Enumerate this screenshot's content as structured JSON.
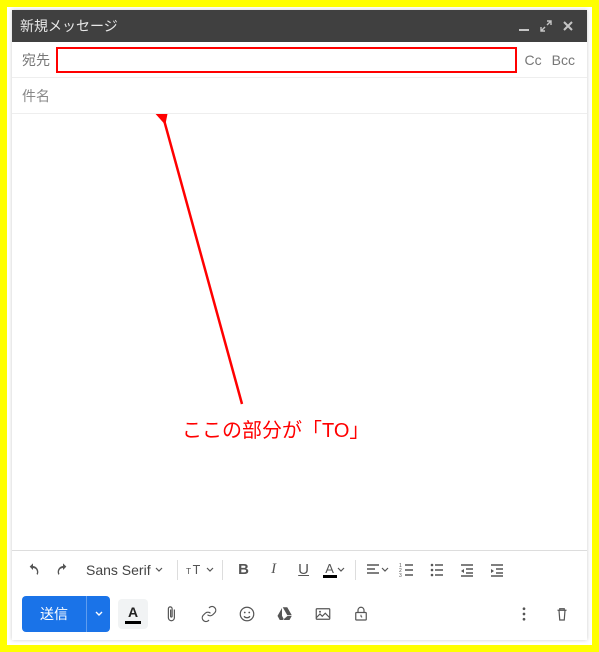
{
  "window": {
    "title": "新規メッセージ"
  },
  "fields": {
    "to_label": "宛先",
    "to_value": "",
    "cc_label": "Cc",
    "bcc_label": "Bcc",
    "subject_placeholder": "件名",
    "subject_value": ""
  },
  "annotation": {
    "text": "ここの部分が「TO」"
  },
  "format": {
    "font_family": "Sans Serif"
  },
  "actions": {
    "send_label": "送信"
  }
}
